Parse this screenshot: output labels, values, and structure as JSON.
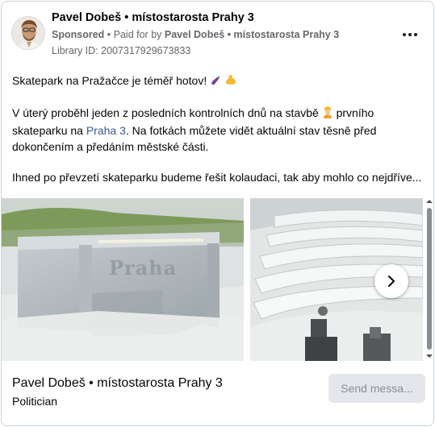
{
  "header": {
    "page_name": "Pavel Dobeš • místostarosta Prahy 3",
    "sponsored": "Sponsored",
    "paid_for_prefix": "Paid for by",
    "paid_for_name": "Pavel Dobeš • místostarosta Prahy 3",
    "library_id": "Library ID: 2007317929673833"
  },
  "post": {
    "line1": "Skatepark na Pražačce je téměř hotov!",
    "para2_part1": "V úterý proběhl jeden z posledních kontrolních dnů na stavbě",
    "para2_part2": "prvního skateparku na",
    "para2_link": "Praha 3",
    "para2_part3": ". Na fotkách můžete vidět aktuální stav těsně před dokončením a předáním městské části.",
    "para3": "Ihned po převzetí skateparku budeme řešit kolaudaci, tak aby mohlo co nejdříve..."
  },
  "carousel": {
    "photo1_engraving": "Praha"
  },
  "footer": {
    "name": "Pavel Dobeš • místostarosta Prahy 3",
    "category": "Politician",
    "send_button": "Send messa..."
  },
  "icons": {
    "more": "more-icon",
    "next": "chevron-right-icon",
    "eggplant": "eggplant-emoji",
    "muscle": "flexed-biceps-emoji",
    "worker": "construction-worker-emoji"
  },
  "colors": {
    "link": "#385898",
    "muted": "#65676b",
    "button_bg": "#e4e6eb"
  }
}
